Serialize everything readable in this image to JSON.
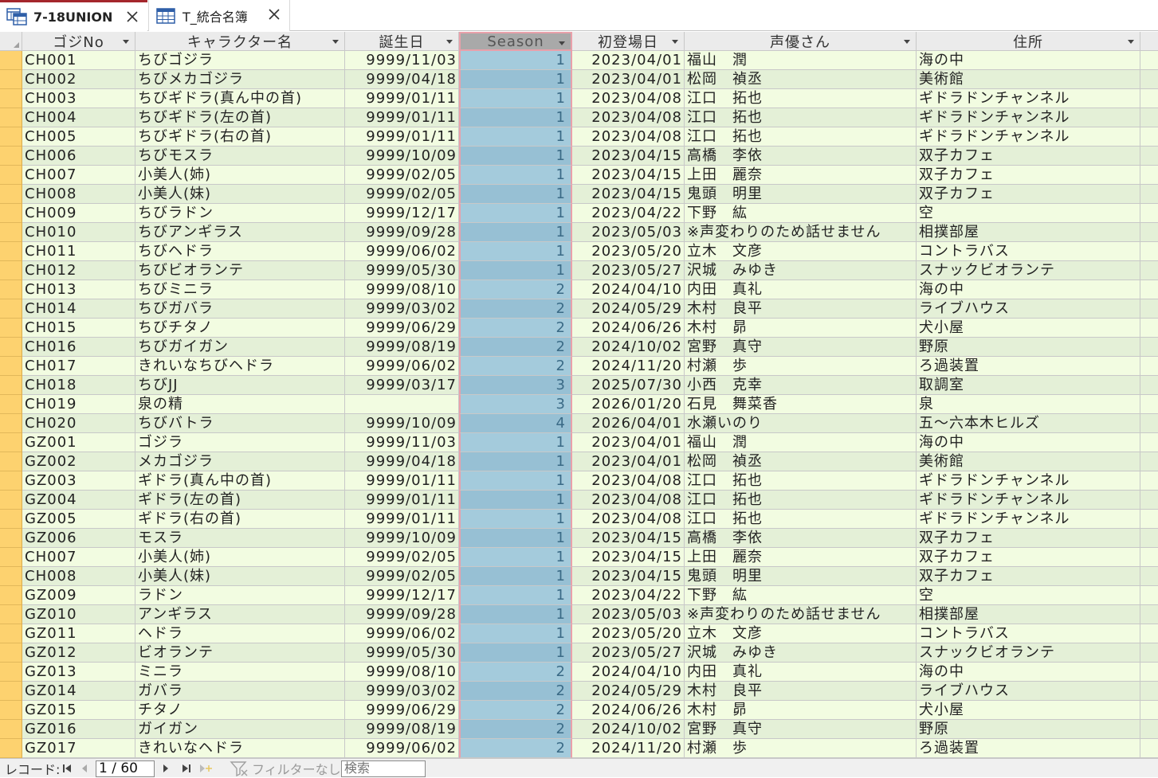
{
  "tabs": [
    {
      "label": "7-18UNION",
      "active": true
    },
    {
      "label": "T_統合名簿",
      "active": false
    }
  ],
  "columns": [
    "ゴジNo",
    "キャラクター名",
    "誕生日",
    "Season",
    "初登場日",
    "声優さん",
    "住所"
  ],
  "rows": [
    [
      "CH001",
      "ちびゴジラ",
      "9999/11/03",
      "1",
      "2023/04/01",
      "福山　潤",
      "海の中"
    ],
    [
      "CH002",
      "ちびメカゴジラ",
      "9999/04/18",
      "1",
      "2023/04/01",
      "松岡　禎丞",
      "美術館"
    ],
    [
      "CH003",
      "ちびギドラ(真ん中の首)",
      "9999/01/11",
      "1",
      "2023/04/08",
      "江口　拓也",
      "ギドラドンチャンネル"
    ],
    [
      "CH004",
      "ちびギドラ(左の首)",
      "9999/01/11",
      "1",
      "2023/04/08",
      "江口　拓也",
      "ギドラドンチャンネル"
    ],
    [
      "CH005",
      "ちびギドラ(右の首)",
      "9999/01/11",
      "1",
      "2023/04/08",
      "江口　拓也",
      "ギドラドンチャンネル"
    ],
    [
      "CH006",
      "ちびモスラ",
      "9999/10/09",
      "1",
      "2023/04/15",
      "高橋　李依",
      "双子カフェ"
    ],
    [
      "CH007",
      "小美人(姉)",
      "9999/02/05",
      "1",
      "2023/04/15",
      "上田　麗奈",
      "双子カフェ"
    ],
    [
      "CH008",
      "小美人(妹)",
      "9999/02/05",
      "1",
      "2023/04/15",
      "鬼頭　明里",
      "双子カフェ"
    ],
    [
      "CH009",
      "ちびラドン",
      "9999/12/17",
      "1",
      "2023/04/22",
      "下野　紘",
      "空"
    ],
    [
      "CH010",
      "ちびアンギラス",
      "9999/09/28",
      "1",
      "2023/05/03",
      "※声変わりのため話せません",
      "相撲部屋"
    ],
    [
      "CH011",
      "ちびヘドラ",
      "9999/06/02",
      "1",
      "2023/05/20",
      "立木　文彦",
      "コントラバス"
    ],
    [
      "CH012",
      "ちびビオランテ",
      "9999/05/30",
      "1",
      "2023/05/27",
      "沢城　みゆき",
      "スナックビオランテ"
    ],
    [
      "CH013",
      "ちびミニラ",
      "9999/08/10",
      "2",
      "2024/04/10",
      "内田　真礼",
      "海の中"
    ],
    [
      "CH014",
      "ちびガバラ",
      "9999/03/02",
      "2",
      "2024/05/29",
      "木村　良平",
      "ライブハウス"
    ],
    [
      "CH015",
      "ちびチタノ",
      "9999/06/29",
      "2",
      "2024/06/26",
      "木村　昴",
      "犬小屋"
    ],
    [
      "CH016",
      "ちびガイガン",
      "9999/08/19",
      "2",
      "2024/10/02",
      "宮野　真守",
      "野原"
    ],
    [
      "CH017",
      "きれいなちびヘドラ",
      "9999/06/02",
      "2",
      "2024/11/20",
      "村瀬　歩",
      "ろ過装置"
    ],
    [
      "CH018",
      "ちびJJ",
      "9999/03/17",
      "3",
      "2025/07/30",
      "小西　克幸",
      "取調室"
    ],
    [
      "CH019",
      "泉の精",
      "",
      "3",
      "2026/01/20",
      "石見　舞菜香",
      "泉"
    ],
    [
      "CH020",
      "ちびバトラ",
      "9999/10/09",
      "4",
      "2026/04/01",
      "水瀬いのり",
      "五～六本木ヒルズ"
    ],
    [
      "GZ001",
      "ゴジラ",
      "9999/11/03",
      "1",
      "2023/04/01",
      "福山　潤",
      "海の中"
    ],
    [
      "GZ002",
      "メカゴジラ",
      "9999/04/18",
      "1",
      "2023/04/01",
      "松岡　禎丞",
      "美術館"
    ],
    [
      "GZ003",
      "ギドラ(真ん中の首)",
      "9999/01/11",
      "1",
      "2023/04/08",
      "江口　拓也",
      "ギドラドンチャンネル"
    ],
    [
      "GZ004",
      "ギドラ(左の首)",
      "9999/01/11",
      "1",
      "2023/04/08",
      "江口　拓也",
      "ギドラドンチャンネル"
    ],
    [
      "GZ005",
      "ギドラ(右の首)",
      "9999/01/11",
      "1",
      "2023/04/08",
      "江口　拓也",
      "ギドラドンチャンネル"
    ],
    [
      "GZ006",
      "モスラ",
      "9999/10/09",
      "1",
      "2023/04/15",
      "高橋　李依",
      "双子カフェ"
    ],
    [
      "CH007",
      "小美人(姉)",
      "9999/02/05",
      "1",
      "2023/04/15",
      "上田　麗奈",
      "双子カフェ"
    ],
    [
      "CH008",
      "小美人(妹)",
      "9999/02/05",
      "1",
      "2023/04/15",
      "鬼頭　明里",
      "双子カフェ"
    ],
    [
      "GZ009",
      "ラドン",
      "9999/12/17",
      "1",
      "2023/04/22",
      "下野　紘",
      "空"
    ],
    [
      "GZ010",
      "アンギラス",
      "9999/09/28",
      "1",
      "2023/05/03",
      "※声変わりのため話せません",
      "相撲部屋"
    ],
    [
      "GZ011",
      "ヘドラ",
      "9999/06/02",
      "1",
      "2023/05/20",
      "立木　文彦",
      "コントラバス"
    ],
    [
      "GZ012",
      "ビオランテ",
      "9999/05/30",
      "1",
      "2023/05/27",
      "沢城　みゆき",
      "スナックビオランテ"
    ],
    [
      "GZ013",
      "ミニラ",
      "9999/08/10",
      "2",
      "2024/04/10",
      "内田　真礼",
      "海の中"
    ],
    [
      "GZ014",
      "ガバラ",
      "9999/03/02",
      "2",
      "2024/05/29",
      "木村　良平",
      "ライブハウス"
    ],
    [
      "GZ015",
      "チタノ",
      "9999/06/29",
      "2",
      "2024/06/26",
      "木村　昴",
      "犬小屋"
    ],
    [
      "GZ016",
      "ガイガン",
      "9999/08/19",
      "2",
      "2024/10/02",
      "宮野　真守",
      "野原"
    ],
    [
      "GZ017",
      "きれいなヘドラ",
      "9999/06/02",
      "2",
      "2024/11/20",
      "村瀬　歩",
      "ろ過装置"
    ]
  ],
  "statusbar": {
    "record_label": "レコード:",
    "record_value": "1 / 60",
    "filter_label": "フィルターなし",
    "search_placeholder": "検索"
  },
  "icons": {
    "query_tab": "query-icon",
    "table_tab": "table-icon",
    "close": "close-icon",
    "filter": "filter-icon"
  },
  "colors": {
    "row_odd": "#f2fce1",
    "row_even": "#e4f0d7",
    "season_col": "#a4cbdc",
    "selector": "#fdd26f",
    "active_tab_accent": "#a4262c",
    "selected_header_border": "#e9a0aa"
  }
}
